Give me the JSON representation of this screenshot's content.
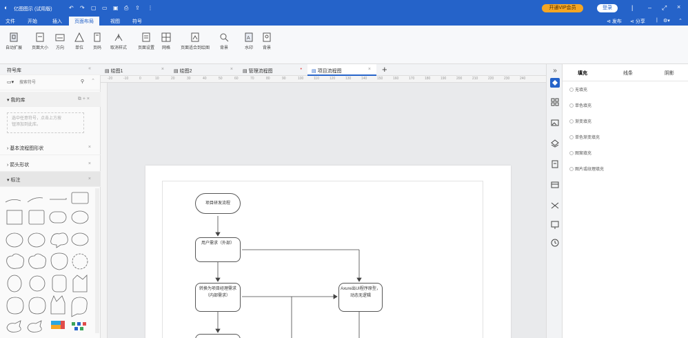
{
  "titlebar": {
    "app_title": "亿图图示 (试用版)",
    "vip_button": "开通VIP会员",
    "login_button": "登录",
    "publish": "发布",
    "share": "分享"
  },
  "menu": {
    "items": [
      "文件",
      "开始",
      "插入",
      "页面布局",
      "视图",
      "符号"
    ],
    "active": "页面布局"
  },
  "ribbon": {
    "buttons": [
      "自动扩展",
      "页面大小",
      "方向",
      "单位",
      "页码",
      "取消样式",
      "页面设置",
      "网格",
      "页面适合到绘图",
      "背景",
      "水印",
      "背景"
    ]
  },
  "library": {
    "title": "符号库",
    "search_placeholder": "搜索符号",
    "my_library": "我的库",
    "empty_hint_line1": "选中任意符号，点击上方按",
    "empty_hint_line2": "钮添加到此库。",
    "sections": [
      "基本流程图形状",
      "箭头形状",
      "标注"
    ]
  },
  "tabs": [
    {
      "label": "绘图1",
      "active": false
    },
    {
      "label": "绘图2",
      "active": false
    },
    {
      "label": "管理流程图",
      "active": false
    },
    {
      "label": "项目流程图",
      "active": true
    }
  ],
  "ruler": {
    "ticks": [
      "-20",
      "-10",
      "0",
      "10",
      "20",
      "30",
      "40",
      "50",
      "60",
      "70",
      "80",
      "90",
      "100",
      "110",
      "120",
      "130",
      "140",
      "150",
      "160",
      "170",
      "180",
      "190",
      "200",
      "210",
      "220",
      "230",
      "240"
    ]
  },
  "flowchart": {
    "start": "项目研发流程",
    "step1": "用户需求（外部）",
    "step2": "转换为项目经理需求（内部需求）",
    "step3": "Axure出UI程序原型，动态无逻辑"
  },
  "fill_panel": {
    "tabs": [
      "填充",
      "线条",
      "阴影"
    ],
    "options": [
      "无填充",
      "单色填充",
      "渐变填充",
      "单色渐变填充",
      "图案填充",
      "图片或纹理填充"
    ]
  },
  "colors": {
    "titlebar": "#2563c9",
    "vip": "#f5a623",
    "accent": "#2563c9"
  }
}
